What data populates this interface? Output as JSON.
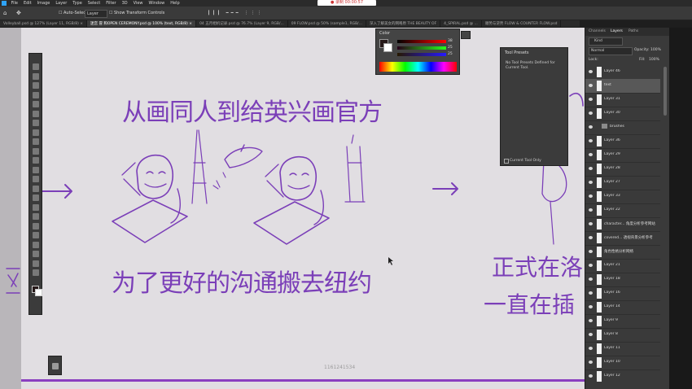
{
  "recording_badge": "● 录制 00:00:57",
  "menu": [
    "File",
    "Edit",
    "Image",
    "Layer",
    "Type",
    "Select",
    "Filter",
    "3D",
    "View",
    "Window",
    "Help"
  ],
  "options": {
    "auto_select_label": "Auto-Select:",
    "auto_select_value": "Layer",
    "show_transform": "Show Transform Controls"
  },
  "tabs": [
    {
      "label": "Volleyball.psd @ 127% (Layer 11, RGB/8) ×",
      "active": false
    },
    {
      "label": "迷宫 冒 和OPEN CEREMONY.psd @ 100% (text, RGB/8) ×",
      "active": true
    },
    {
      "label": "04 五月相机记录.psd @ 76.7% (Layer 9, RGB/...",
      "active": false
    },
    {
      "label": "09 FLOW.psd @ 50% (sample1, RGB/...",
      "active": false
    },
    {
      "label": "深入了解美女的网咯原 THE BEAUTY OF",
      "active": false
    },
    {
      "label": "4_SPIRAL.psd @ ...",
      "active": false
    },
    {
      "label": "顺势与逆势 FLOW & COUNTER FLOW.psd",
      "active": false
    }
  ],
  "color_panel": {
    "title": "Color",
    "r": "38",
    "g": "25",
    "b": "25"
  },
  "tool_presets": {
    "title": "Tool Presets",
    "empty_message": "No Tool Presets Defined for Current Tool.",
    "current_tool_only": "Current Tool Only"
  },
  "layers_panel": {
    "tabs": [
      "Channels",
      "Layers",
      "Paths"
    ],
    "kind": "Kind",
    "blend_mode": "Normal",
    "opacity_label": "Opacity:",
    "opacity_value": "100%",
    "lock_label": "Lock:",
    "fill_label": "Fill:",
    "fill_value": "100%",
    "layers": [
      {
        "name": "Layer 46",
        "type": "layer",
        "selected": false
      },
      {
        "name": "text",
        "type": "layer",
        "selected": true
      },
      {
        "name": "Layer 31",
        "type": "layer",
        "selected": false
      },
      {
        "name": "Layer 30",
        "type": "layer",
        "selected": false
      },
      {
        "name": "brushes",
        "type": "folder",
        "selected": false
      },
      {
        "name": "Layer 36",
        "type": "layer",
        "selected": false
      },
      {
        "name": "Layer 29",
        "type": "layer",
        "selected": false
      },
      {
        "name": "Layer 28",
        "type": "layer",
        "selected": false
      },
      {
        "name": "Layer 27",
        "type": "layer",
        "selected": false
      },
      {
        "name": "Layer 33",
        "type": "layer",
        "selected": false
      },
      {
        "name": "Layer 22",
        "type": "layer",
        "selected": false
      },
      {
        "name": "character... 角度分析参考网站",
        "type": "layer",
        "selected": false
      },
      {
        "name": "covered... 透视背景分析参考",
        "type": "layer",
        "selected": false
      },
      {
        "name": "角色性格分析网络",
        "type": "layer",
        "selected": false
      },
      {
        "name": "Layer 21",
        "type": "layer",
        "selected": false
      },
      {
        "name": "Layer 18",
        "type": "layer",
        "selected": false
      },
      {
        "name": "Layer 16",
        "type": "layer",
        "selected": false
      },
      {
        "name": "Layer 14",
        "type": "layer",
        "selected": false
      },
      {
        "name": "Layer 9",
        "type": "layer",
        "selected": false
      },
      {
        "name": "Layer 8",
        "type": "layer",
        "selected": false
      },
      {
        "name": "Layer 11",
        "type": "layer",
        "selected": false
      },
      {
        "name": "Layer 10",
        "type": "layer",
        "selected": false
      },
      {
        "name": "Layer 12",
        "type": "layer",
        "selected": false
      }
    ]
  },
  "canvas": {
    "heading_top": "从画同人到给英兴画官方",
    "heading_bottom": "为了更好的沟通搬去纽约",
    "right_text_1": "正式在洛",
    "right_text_2": "一直在插",
    "watermark": "1161241534",
    "stroke_color": "#7b3fb8"
  }
}
